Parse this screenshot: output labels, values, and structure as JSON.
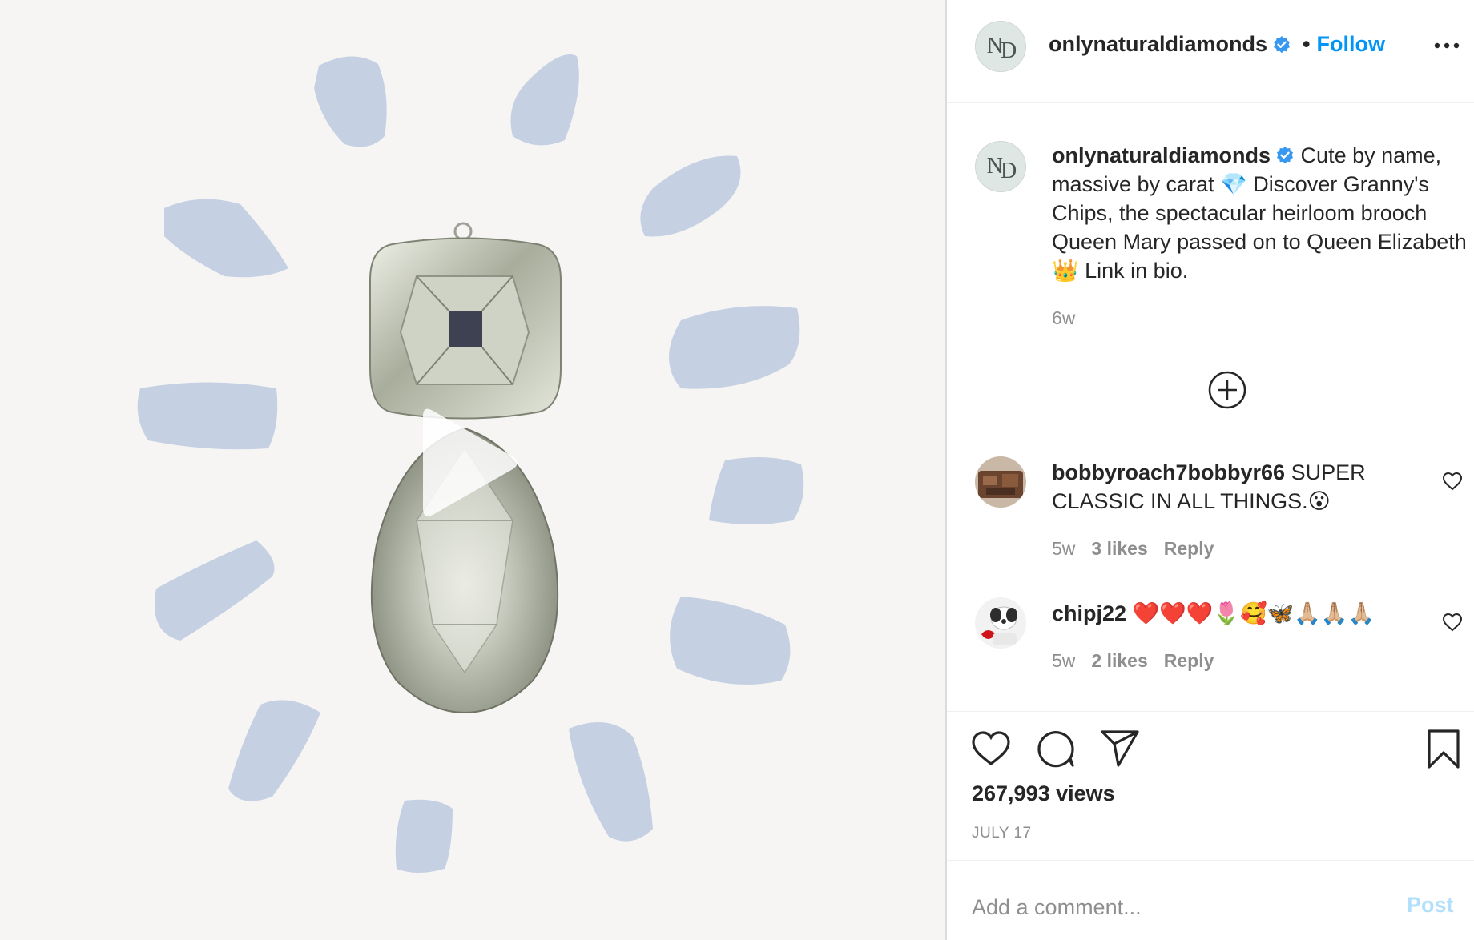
{
  "post": {
    "username": "onlynaturaldiamonds",
    "follow_label": "Follow",
    "separator": "•",
    "avatar_monogram_n": "N",
    "avatar_monogram_d": "D"
  },
  "caption": {
    "username": "onlynaturaldiamonds",
    "part1": " Cute by name, massive by carat ",
    "emoji_diamond": "💎",
    "part2": " Discover Granny's Chips, the spectacular heirloom brooch Queen Mary passed on to Queen Elizabeth ",
    "emoji_crown": "👑",
    "part3": " Link in bio.",
    "time": "6w"
  },
  "comments": [
    {
      "username": "bobbyroach7bobbyr66",
      "text": " SUPER CLASSIC IN ALL THINGS.😮",
      "time": "5w",
      "likes": "3 likes",
      "reply_label": "Reply"
    },
    {
      "username": "chipj22",
      "text": " ❤️❤️❤️🌷🥰🦋🙏🏼🙏🏼🙏🏼",
      "time": "5w",
      "likes": "2 likes",
      "reply_label": "Reply"
    }
  ],
  "stats": {
    "views": "267,993 views",
    "date": "JULY 17"
  },
  "composer": {
    "placeholder": "Add a comment...",
    "post_label": "Post"
  },
  "icons": {
    "verified": "verified-badge-icon",
    "more": "more-options-icon",
    "load_more": "load-more-comments-icon",
    "like": "heart-icon",
    "comment": "comment-bubble-icon",
    "share": "paper-plane-icon",
    "save": "bookmark-icon",
    "play": "play-icon"
  },
  "colors": {
    "accent": "#0095f6",
    "verified": "#3897f0",
    "splash": "#c5d1e3",
    "media_bg": "#f6f5f3"
  }
}
